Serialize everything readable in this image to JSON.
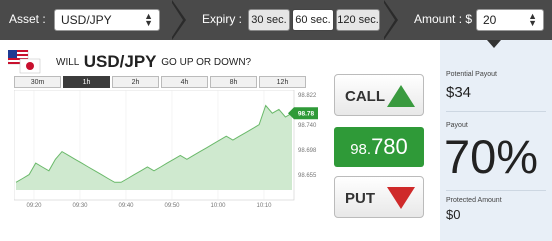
{
  "topbar": {
    "asset_label": "Asset :",
    "asset_value": "USD/JPY",
    "expiry_label": "Expiry :",
    "expiry_options": [
      "30 sec.",
      "60 sec.",
      "120 sec."
    ],
    "expiry_selected": "60 sec.",
    "amount_label": "Amount : $",
    "amount_value": "20"
  },
  "question": {
    "prefix": "WILL",
    "pair": "USD/JPY",
    "suffix": "GO UP OR DOWN?"
  },
  "timeframes": [
    "30m",
    "1h",
    "2h",
    "4h",
    "8h",
    "12h"
  ],
  "timeframe_active": "1h",
  "buttons": {
    "call": "CALL",
    "put": "PUT"
  },
  "price": {
    "prefix": "98.",
    "main": "780"
  },
  "payout": {
    "potential_label": "Potential Payout",
    "potential_value": "$34",
    "payout_label": "Payout",
    "payout_value": "70%",
    "protected_label": "Protected Amount",
    "protected_value": "$0"
  },
  "colors": {
    "call_green": "#3a9a3f",
    "put_red": "#cf2a2a",
    "price_bg": "#2f9a38",
    "area_fill": "#cfe9cf",
    "line": "#6ab96a"
  },
  "chart_data": {
    "type": "area",
    "x_ticks": [
      "09:20",
      "09:30",
      "09:40",
      "09:50",
      "10:00",
      "10:10"
    ],
    "y_ticks": [
      "98.822",
      "98.740",
      "98.698",
      "98.655"
    ],
    "last_price_label": "98.78",
    "values": [
      98.6,
      98.61,
      98.62,
      98.65,
      98.64,
      98.63,
      98.66,
      98.68,
      98.67,
      98.66,
      98.65,
      98.64,
      98.63,
      98.62,
      98.61,
      98.6,
      98.6,
      98.61,
      98.62,
      98.63,
      98.64,
      98.63,
      98.64,
      98.65,
      98.66,
      98.67,
      98.66,
      98.67,
      98.68,
      98.69,
      98.7,
      98.71,
      98.72,
      98.71,
      98.72,
      98.73,
      98.74,
      98.75,
      98.8,
      98.78,
      98.79,
      98.77,
      98.78
    ],
    "ylim": [
      98.58,
      98.83
    ]
  }
}
